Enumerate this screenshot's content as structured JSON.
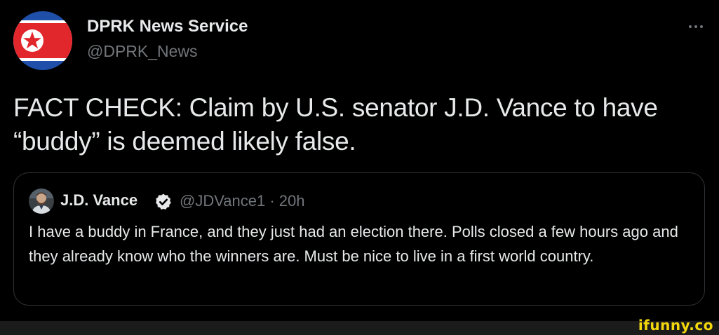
{
  "tweet": {
    "author_name": "DPRK News Service",
    "author_handle": "@DPRK_News",
    "more_icon": "more-horizontal-icon",
    "text": "FACT CHECK: Claim by U.S. senator J.D. Vance to have “buddy” is deemed likely false."
  },
  "quote": {
    "author_name": "J.D. Vance",
    "verified_icon": "verified-badge-icon",
    "author_handle": "@JDVance1 · 20h",
    "text": "I have a buddy in France, and they just had an election there. Polls closed a few hours ago and they already know who the winners are. Must be nice to live in a first world country."
  },
  "watermark": {
    "text": "ifunny.co"
  },
  "colors": {
    "background": "#000000",
    "primary_text": "#e7e9ea",
    "secondary_text": "#71767b",
    "border": "#2f3336",
    "flag_blue": "#1f4fa8",
    "flag_red": "#e1262c",
    "watermark": "#f4d70c"
  }
}
